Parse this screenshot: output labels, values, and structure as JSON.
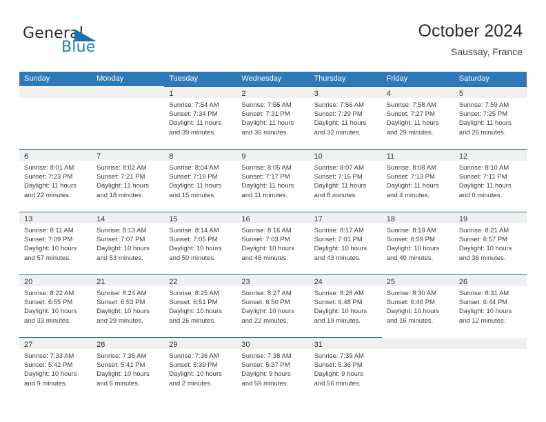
{
  "brand": {
    "name_top": "General",
    "name_bottom": "Blue",
    "triangle_icon": "triangle-icon",
    "color_dark": "#2b2b2b",
    "color_blue": "#1a7ec8"
  },
  "header": {
    "title": "October 2024",
    "subtitle": "Saussay, France"
  },
  "theme": {
    "header_blue": "#3079b8",
    "row_rule_blue": "#2e6da4",
    "daynum_band": "#f0f0f0",
    "text": "#3c3c3c"
  },
  "calendar": {
    "weekdays": [
      "Sunday",
      "Monday",
      "Tuesday",
      "Wednesday",
      "Thursday",
      "Friday",
      "Saturday"
    ],
    "weeks": [
      [
        {
          "blank": true
        },
        {
          "blank": true
        },
        {
          "day": "1",
          "sunrise": "Sunrise: 7:54 AM",
          "sunset": "Sunset: 7:34 PM",
          "daylight1": "Daylight: 11 hours",
          "daylight2": "and 39 minutes."
        },
        {
          "day": "2",
          "sunrise": "Sunrise: 7:55 AM",
          "sunset": "Sunset: 7:31 PM",
          "daylight1": "Daylight: 11 hours",
          "daylight2": "and 36 minutes."
        },
        {
          "day": "3",
          "sunrise": "Sunrise: 7:56 AM",
          "sunset": "Sunset: 7:29 PM",
          "daylight1": "Daylight: 11 hours",
          "daylight2": "and 32 minutes."
        },
        {
          "day": "4",
          "sunrise": "Sunrise: 7:58 AM",
          "sunset": "Sunset: 7:27 PM",
          "daylight1": "Daylight: 11 hours",
          "daylight2": "and 29 minutes."
        },
        {
          "day": "5",
          "sunrise": "Sunrise: 7:59 AM",
          "sunset": "Sunset: 7:25 PM",
          "daylight1": "Daylight: 11 hours",
          "daylight2": "and 25 minutes."
        }
      ],
      [
        {
          "day": "6",
          "sunrise": "Sunrise: 8:01 AM",
          "sunset": "Sunset: 7:23 PM",
          "daylight1": "Daylight: 11 hours",
          "daylight2": "and 22 minutes."
        },
        {
          "day": "7",
          "sunrise": "Sunrise: 8:02 AM",
          "sunset": "Sunset: 7:21 PM",
          "daylight1": "Daylight: 11 hours",
          "daylight2": "and 18 minutes."
        },
        {
          "day": "8",
          "sunrise": "Sunrise: 8:04 AM",
          "sunset": "Sunset: 7:19 PM",
          "daylight1": "Daylight: 11 hours",
          "daylight2": "and 15 minutes."
        },
        {
          "day": "9",
          "sunrise": "Sunrise: 8:05 AM",
          "sunset": "Sunset: 7:17 PM",
          "daylight1": "Daylight: 11 hours",
          "daylight2": "and 11 minutes."
        },
        {
          "day": "10",
          "sunrise": "Sunrise: 8:07 AM",
          "sunset": "Sunset: 7:15 PM",
          "daylight1": "Daylight: 11 hours",
          "daylight2": "and 8 minutes."
        },
        {
          "day": "11",
          "sunrise": "Sunrise: 8:08 AM",
          "sunset": "Sunset: 7:13 PM",
          "daylight1": "Daylight: 11 hours",
          "daylight2": "and 4 minutes."
        },
        {
          "day": "12",
          "sunrise": "Sunrise: 8:10 AM",
          "sunset": "Sunset: 7:11 PM",
          "daylight1": "Daylight: 11 hours",
          "daylight2": "and 0 minutes."
        }
      ],
      [
        {
          "day": "13",
          "sunrise": "Sunrise: 8:11 AM",
          "sunset": "Sunset: 7:09 PM",
          "daylight1": "Daylight: 10 hours",
          "daylight2": "and 57 minutes."
        },
        {
          "day": "14",
          "sunrise": "Sunrise: 8:13 AM",
          "sunset": "Sunset: 7:07 PM",
          "daylight1": "Daylight: 10 hours",
          "daylight2": "and 53 minutes."
        },
        {
          "day": "15",
          "sunrise": "Sunrise: 8:14 AM",
          "sunset": "Sunset: 7:05 PM",
          "daylight1": "Daylight: 10 hours",
          "daylight2": "and 50 minutes."
        },
        {
          "day": "16",
          "sunrise": "Sunrise: 8:16 AM",
          "sunset": "Sunset: 7:03 PM",
          "daylight1": "Daylight: 10 hours",
          "daylight2": "and 46 minutes."
        },
        {
          "day": "17",
          "sunrise": "Sunrise: 8:17 AM",
          "sunset": "Sunset: 7:01 PM",
          "daylight1": "Daylight: 10 hours",
          "daylight2": "and 43 minutes."
        },
        {
          "day": "18",
          "sunrise": "Sunrise: 8:19 AM",
          "sunset": "Sunset: 6:59 PM",
          "daylight1": "Daylight: 10 hours",
          "daylight2": "and 40 minutes."
        },
        {
          "day": "19",
          "sunrise": "Sunrise: 8:21 AM",
          "sunset": "Sunset: 6:57 PM",
          "daylight1": "Daylight: 10 hours",
          "daylight2": "and 36 minutes."
        }
      ],
      [
        {
          "day": "20",
          "sunrise": "Sunrise: 8:22 AM",
          "sunset": "Sunset: 6:55 PM",
          "daylight1": "Daylight: 10 hours",
          "daylight2": "and 33 minutes."
        },
        {
          "day": "21",
          "sunrise": "Sunrise: 8:24 AM",
          "sunset": "Sunset: 6:53 PM",
          "daylight1": "Daylight: 10 hours",
          "daylight2": "and 29 minutes."
        },
        {
          "day": "22",
          "sunrise": "Sunrise: 8:25 AM",
          "sunset": "Sunset: 6:51 PM",
          "daylight1": "Daylight: 10 hours",
          "daylight2": "and 26 minutes."
        },
        {
          "day": "23",
          "sunrise": "Sunrise: 8:27 AM",
          "sunset": "Sunset: 6:50 PM",
          "daylight1": "Daylight: 10 hours",
          "daylight2": "and 22 minutes."
        },
        {
          "day": "24",
          "sunrise": "Sunrise: 8:28 AM",
          "sunset": "Sunset: 6:48 PM",
          "daylight1": "Daylight: 10 hours",
          "daylight2": "and 19 minutes."
        },
        {
          "day": "25",
          "sunrise": "Sunrise: 8:30 AM",
          "sunset": "Sunset: 6:46 PM",
          "daylight1": "Daylight: 10 hours",
          "daylight2": "and 16 minutes."
        },
        {
          "day": "26",
          "sunrise": "Sunrise: 8:31 AM",
          "sunset": "Sunset: 6:44 PM",
          "daylight1": "Daylight: 10 hours",
          "daylight2": "and 12 minutes."
        }
      ],
      [
        {
          "day": "27",
          "sunrise": "Sunrise: 7:33 AM",
          "sunset": "Sunset: 5:42 PM",
          "daylight1": "Daylight: 10 hours",
          "daylight2": "and 9 minutes."
        },
        {
          "day": "28",
          "sunrise": "Sunrise: 7:35 AM",
          "sunset": "Sunset: 5:41 PM",
          "daylight1": "Daylight: 10 hours",
          "daylight2": "and 6 minutes."
        },
        {
          "day": "29",
          "sunrise": "Sunrise: 7:36 AM",
          "sunset": "Sunset: 5:39 PM",
          "daylight1": "Daylight: 10 hours",
          "daylight2": "and 2 minutes."
        },
        {
          "day": "30",
          "sunrise": "Sunrise: 7:38 AM",
          "sunset": "Sunset: 5:37 PM",
          "daylight1": "Daylight: 9 hours",
          "daylight2": "and 59 minutes."
        },
        {
          "day": "31",
          "sunrise": "Sunrise: 7:39 AM",
          "sunset": "Sunset: 5:36 PM",
          "daylight1": "Daylight: 9 hours",
          "daylight2": "and 56 minutes."
        },
        {
          "blank": true,
          "gray": true
        },
        {
          "blank": true,
          "gray": true
        }
      ]
    ]
  }
}
